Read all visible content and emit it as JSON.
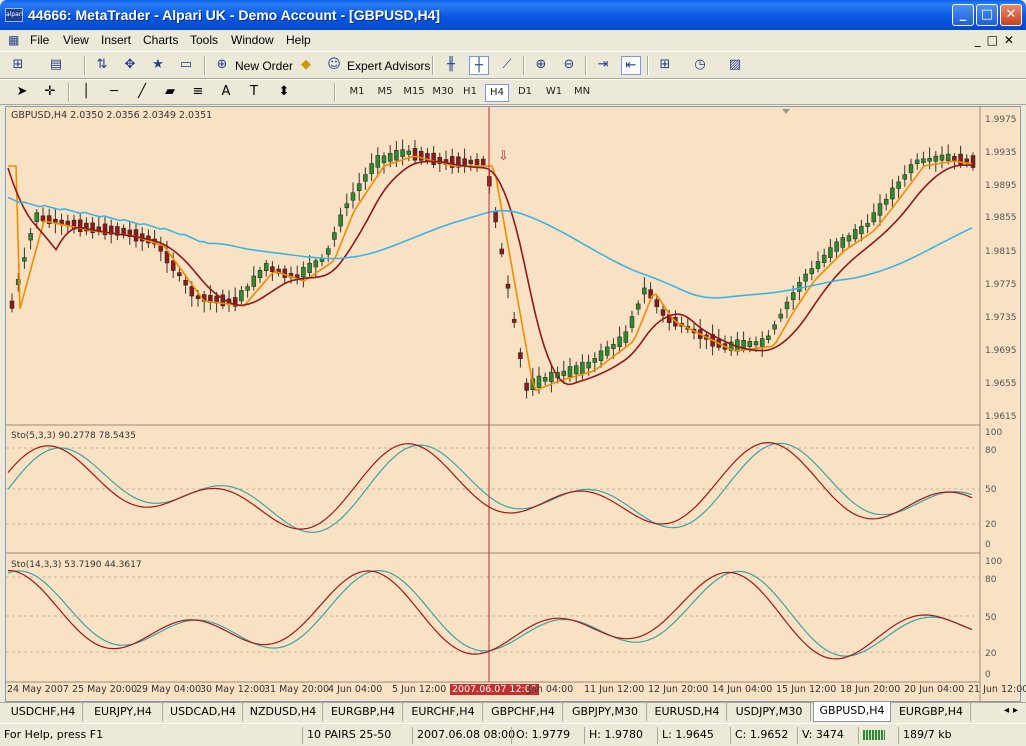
{
  "window": {
    "title": "44666: MetaTrader - Alpari UK - Demo Account - [GBPUSD,H4]",
    "app_icon_text": "alpari",
    "min": "_",
    "max": "□",
    "close": "✕"
  },
  "menu": [
    "File",
    "View",
    "Insert",
    "Charts",
    "Tools",
    "Window",
    "Help"
  ],
  "toolbar": {
    "new_order": "New Order",
    "expert_advisors": "Expert Advisors"
  },
  "timeframes": [
    "M1",
    "M5",
    "M15",
    "M30",
    "H1",
    "H4",
    "D1",
    "W1",
    "MN"
  ],
  "active_timeframe": "H4",
  "chart": {
    "info": "GBPUSD,H4  2.0350 2.0356 2.0349 2.0351",
    "price_labels": [
      "1.9975",
      "1.9935",
      "1.9895",
      "1.9855",
      "1.9815",
      "1.9775",
      "1.9735",
      "1.9695",
      "1.9655",
      "1.9615"
    ],
    "stoch1_label": "Sto(5,3,3) 90.2778 78.5435",
    "stoch2_label": "Sto(14,3,3) 53.7190 44.3617",
    "stoch_levels": [
      "100",
      "80",
      "50",
      "20",
      "0"
    ],
    "time_labels": [
      "24 May 2007",
      "25 May 20:00",
      "29 May 04:00",
      "30 May 12:00",
      "31 May 20:00",
      "4 Jun 04:00",
      "5 Jun 12:00",
      "2007.06.07 12:00",
      "Jun 04:00",
      "11 Jun 12:00",
      "12 Jun 20:00",
      "14 Jun 04:00",
      "15 Jun 12:00",
      "18 Jun 20:00",
      "20 Jun 04:00",
      "21 Jun 12:00"
    ],
    "crosshair_time": "2007.06.07 12:00",
    "colors": {
      "background": "#f9e2c3",
      "bull": "#2f8a2f",
      "bear": "#8b1a1a",
      "ma_fast": "#f08c00",
      "ma_mid": "#8b1a1a",
      "ma_slow": "#3ab4e8",
      "crosshair": "#b03030"
    }
  },
  "tabs": [
    "USDCHF,H4",
    "EURJPY,H4",
    "USDCAD,H4",
    "NZDUSD,H4",
    "EURGBP,H4",
    "EURCHF,H4",
    "GBPCHF,H4",
    "GBPJPY,M30",
    "EURUSD,H4",
    "USDJPY,M30",
    "GBPUSD,H4",
    "EURGBP,H4"
  ],
  "active_tab": "GBPUSD,H4",
  "status": {
    "help": "For Help, press F1",
    "profile": "10 PAIRS 25-50",
    "time": "2007.06.08 08:00",
    "open": "O: 1.9779",
    "high": "H: 1.9780",
    "low": "L: 1.9645",
    "close": "C: 1.9652",
    "volume": "V: 3474",
    "traffic": "189/7 kb"
  }
}
